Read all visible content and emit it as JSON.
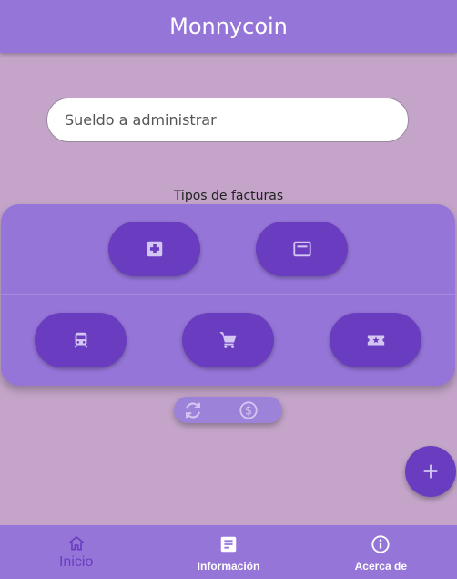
{
  "app": {
    "title": "Monnycoin"
  },
  "salary_field": {
    "placeholder": "Sueldo a administrar",
    "value": ""
  },
  "invoice_types": {
    "label": "Tipos de facturas",
    "row1": [
      {
        "icon": "medical-plus-icon"
      },
      {
        "icon": "card-icon"
      }
    ],
    "row2": [
      {
        "icon": "train-icon"
      },
      {
        "icon": "cart-icon"
      },
      {
        "icon": "ticket-star-icon"
      }
    ]
  },
  "toggle": {
    "icons": [
      "sync-icon",
      "dollar-circle-icon"
    ]
  },
  "fab": {
    "icon": "plus-icon"
  },
  "bottom_nav": {
    "items": [
      {
        "label": "Inicio",
        "icon": "home-icon",
        "active": true
      },
      {
        "label": "Información",
        "icon": "article-icon",
        "active": false
      },
      {
        "label": "Acerca de",
        "icon": "info-icon",
        "active": false
      }
    ]
  },
  "colors": {
    "background": "#c4a5c9",
    "primary": "#9575d8",
    "accent": "#6a3dc0",
    "icon_light": "#d4c6f2"
  }
}
